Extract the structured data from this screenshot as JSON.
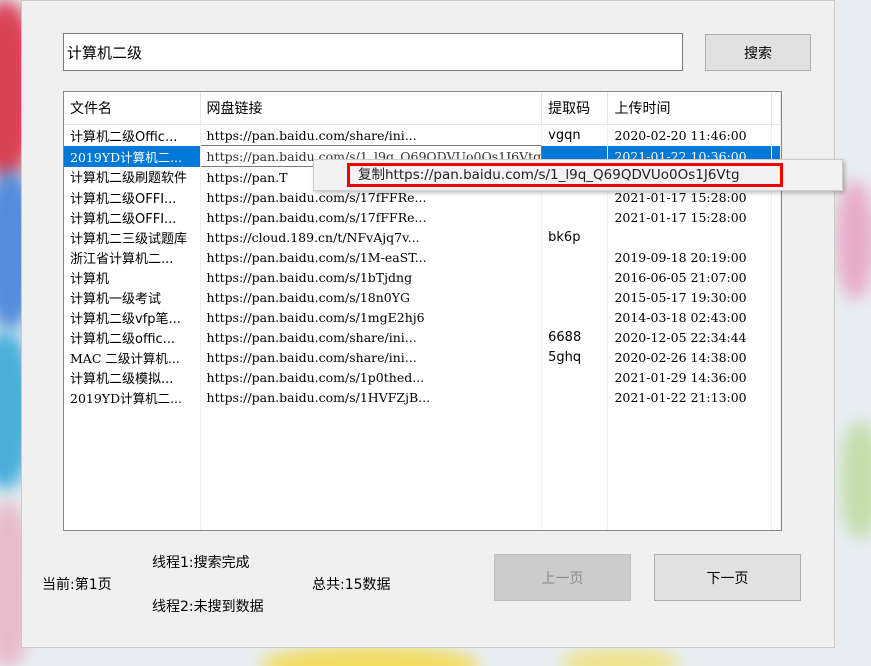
{
  "search": {
    "value": "计算机二级",
    "button_label": "搜索"
  },
  "table": {
    "headers": [
      "文件名",
      "网盘链接",
      "提取码",
      "上传时间"
    ],
    "rows": [
      [
        "计算机二级Offic...",
        "https://pan.baidu.com/share/ini...",
        "vgqn",
        "2020-02-20 11:46:00"
      ],
      [
        "2019YD计算机二...",
        "https://pan.baidu.com/s/1_l9q_Q69QDVUo0Os1J6Vtg",
        "",
        "2021-01-22 10:36:00"
      ],
      [
        "计算机二级刷题软件",
        "https://pan.T",
        "",
        ""
      ],
      [
        "计算机二级OFFI...",
        "https://pan.baidu.com/s/17fFFRe...",
        "",
        "2021-01-17 15:28:00"
      ],
      [
        "计算机二级OFFI...",
        "https://pan.baidu.com/s/17fFFRe...",
        "",
        "2021-01-17 15:28:00"
      ],
      [
        "计算机二三级试题库",
        "https://cloud.189.cn/t/NFvAjq7v...",
        "bk6p",
        ""
      ],
      [
        "浙江省计算机二...",
        "https://pan.baidu.com/s/1M-eaST...",
        "",
        "2019-09-18 20:19:00"
      ],
      [
        "计算机",
        "https://pan.baidu.com/s/1bTjdng",
        "",
        "2016-06-05 21:07:00"
      ],
      [
        "计算机一级考试",
        "https://pan.baidu.com/s/18n0YG",
        "",
        "2015-05-17 19:30:00"
      ],
      [
        "计算机二级vfp笔...",
        "https://pan.baidu.com/s/1mgE2hj6",
        "",
        "2014-03-18 02:43:00"
      ],
      [
        "计算机二级offic...",
        "https://pan.baidu.com/share/ini...",
        "6688",
        "2020-12-05 22:34:44"
      ],
      [
        "MAC 二级计算机...",
        "https://pan.baidu.com/share/ini...",
        "5ghq",
        "2020-02-26 14:38:00"
      ],
      [
        "计算机二级模拟...",
        "https://pan.baidu.com/s/1p0thed...",
        "",
        "2021-01-29 14:36:00"
      ],
      [
        "2019YD计算机二...",
        "https://pan.baidu.com/s/1HVFZjB...",
        "",
        "2021-01-22 21:13:00"
      ]
    ]
  },
  "context_menu": {
    "copy_label": "复制https://pan.baidu.com/s/1_l9q_Q69QDVUo0Os1J6Vtg"
  },
  "status": {
    "thread1": "线程1:搜索完成",
    "thread2": "线程2:未搜到数据",
    "current_page": "当前:第1页",
    "total": "总共:15数据"
  },
  "pager": {
    "prev_label": "上一页",
    "next_label": "下一页"
  },
  "colors": {
    "selection": "#0078d7",
    "highlight_box": "#e00000"
  }
}
